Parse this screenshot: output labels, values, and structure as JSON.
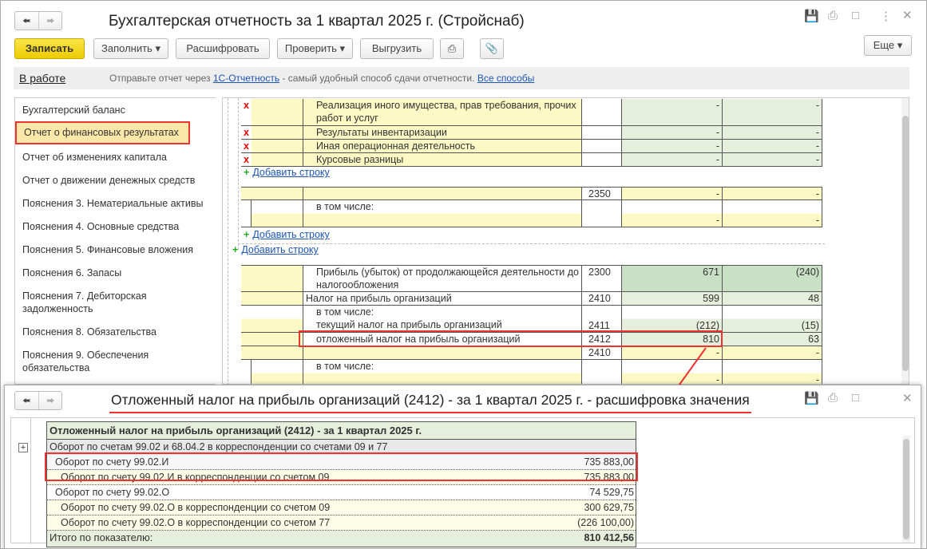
{
  "window": {
    "title": "Бухгалтерская отчетность за 1 квартал 2025 г. (Стройснаб)"
  },
  "toolbar": {
    "save": "Записать",
    "fill": "Заполнить",
    "decode": "Расшифровать",
    "check": "Проверить",
    "export": "Выгрузить",
    "more": "Еще"
  },
  "status": {
    "state": "В работе",
    "prefix": "Отправьте отчет через",
    "link": "1С-Отчетность",
    "suffix": "- самый удобный способ сдачи отчетности.",
    "all": "Все способы"
  },
  "sidebar": {
    "items": [
      "Бухгалтерский баланс",
      "Отчет о финансовых результатах",
      "Отчет об изменениях капитала",
      "Отчет о движении денежных средств",
      "Пояснения 3. Нематериальные активы",
      "Пояснения 4. Основные средства",
      "Пояснения 5. Финансовые вложения",
      "Пояснения 6. Запасы",
      "Пояснения 7. Дебиторская задолженность",
      "Пояснения 8. Обязательства",
      "Пояснения 9. Обеспечения обязательства"
    ],
    "selected": 1
  },
  "report": {
    "add_row": "Добавить строку",
    "rows": [
      {
        "name": "Реализация иного имущества, прав требования, прочих работ и услуг",
        "code": "",
        "v1": "-",
        "v2": "-"
      },
      {
        "name": "Результаты инвентаризации",
        "code": "",
        "v1": "-",
        "v2": "-"
      },
      {
        "name": "Иная операционная деятельность",
        "code": "",
        "v1": "-",
        "v2": "-"
      },
      {
        "name": "Курсовые разницы",
        "code": "",
        "v1": "-",
        "v2": "-"
      },
      {
        "name": "",
        "code": "2350",
        "v1": "-",
        "v2": "-"
      },
      {
        "name": "в том числе:",
        "code": "",
        "v1": "-",
        "v2": "-"
      },
      {
        "name": "Прибыль (убыток) от продолжающейся деятельности до налогообложения",
        "code": "2300",
        "v1": "671",
        "v2": "(240)"
      },
      {
        "name": "Налог на прибыль организаций",
        "code": "2410",
        "v1": "599",
        "v2": "48"
      },
      {
        "name": "в том числе:",
        "code": "",
        "v1": "",
        "v2": ""
      },
      {
        "name": "текущий налог на прибыль организаций",
        "code": "2411",
        "v1": "(212)",
        "v2": "(15)"
      },
      {
        "name": "отложенный налог на прибыль организаций",
        "code": "2412",
        "v1": "810",
        "v2": "63"
      },
      {
        "name": "",
        "code": "2410",
        "v1": "-",
        "v2": "-"
      },
      {
        "name": "в том числе:",
        "code": "",
        "v1": "-",
        "v2": "-"
      }
    ]
  },
  "decoding": {
    "title": "Отложенный налог на прибыль организаций (2412) - за 1 квартал 2025 г. - расшифровка значения",
    "header": "Отложенный налог на прибыль организаций (2412) - за 1 квартал 2025 г.",
    "group": "Оборот по счетам 99.02 и 68.04.2 в корреспонденции со счетами 09 и 77",
    "lines": [
      {
        "label": "Оборот по счету 99.02.И",
        "value": "735 883,00"
      },
      {
        "label": "Оборот по счету 99.02.И  в корреспонденции со счетом 09",
        "value": "735 883,00"
      },
      {
        "label": "Оборот по счету 99.02.О",
        "value": "74 529,75"
      },
      {
        "label": "Оборот по счету 99.02.О в корреспонденции со счетом 09",
        "value": "300 629,75"
      },
      {
        "label": "Оборот по счету 99.02.О в корреспонденции со счетом 77",
        "value": "(226 100,00)"
      }
    ],
    "total_label": "Итого по показателю:",
    "total_value": "810 412,56"
  },
  "colors": {
    "primary": "#f5d800",
    "highlight": "#e33333",
    "link": "#1d55b5"
  }
}
